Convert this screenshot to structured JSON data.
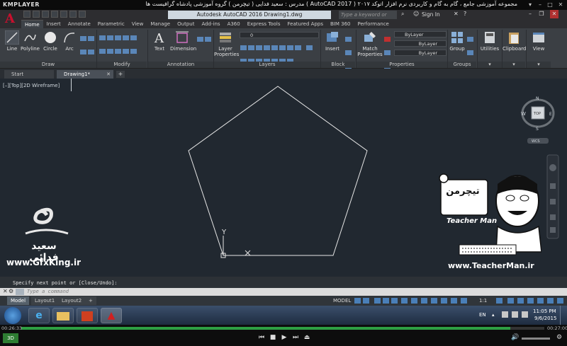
{
  "player": {
    "logo": "KMPLAYER",
    "title": "مجموعه آموزشی جامع ، گام به گام و کاربردی نرم افزار  اتوکد ٢٠١٧ ( AutoCAD  2017 )  مدرس : سعید فدایی ( تیچرمن ) گروه آموزشی پادشاه گرافیست ها",
    "time_elapsed": "00:26:33",
    "time_total": "00:27:00",
    "progress_fraction": 0.935
  },
  "autocad": {
    "app_title": "Autodesk AutoCAD 2016   Drawing1.dwg",
    "search_placeholder": "Type a keyword or phrase",
    "sign_in": "Sign In",
    "tabs": [
      "Home",
      "Insert",
      "Annotate",
      "Parametric",
      "View",
      "Manage",
      "Output",
      "Add-ins",
      "A360",
      "Express Tools",
      "Featured Apps",
      "BIM 360",
      "Performance"
    ],
    "active_tab": "Home",
    "ribbon": {
      "draw": {
        "label": "Draw",
        "buttons": [
          "Line",
          "Polyline",
          "Circle",
          "Arc"
        ]
      },
      "modify": {
        "label": "Modify"
      },
      "annotation": {
        "label": "Annotation",
        "buttons": [
          "Text",
          "Dimension"
        ]
      },
      "layers": {
        "label": "Layers",
        "button": "Layer Properties",
        "layer_value": "0"
      },
      "block": {
        "label": "Block",
        "button": "Insert"
      },
      "properties": {
        "label": "Properties",
        "button": "Match Properties",
        "values": [
          "ByLayer",
          "ByLayer",
          "ByLayer"
        ]
      },
      "groups": {
        "label": "Groups",
        "button": "Group"
      },
      "utilities": {
        "button": "Utilities"
      },
      "clipboard": {
        "button": "Clipboard"
      },
      "view": {
        "button": "View"
      }
    },
    "file_tabs": [
      "Start",
      "Drawing1*"
    ],
    "viewport_label": "[–][Top][2D Wireframe]",
    "viewcube": {
      "top": "TOP",
      "n": "N",
      "s": "S",
      "e": "E",
      "w": "W",
      "wcs": "WCS"
    },
    "ucs": {
      "y": "Y",
      "x": "X"
    },
    "command_history": "Specify next point or [Close/Undo]:",
    "command_placeholder": "Type a command",
    "layout_tabs": [
      "Model",
      "Layout1",
      "Layout2"
    ],
    "status": {
      "model": "MODEL",
      "scale": "1:1"
    }
  },
  "watermarks": {
    "left_name": "سعید فدائی",
    "left_site": "www.GfxKing.ir",
    "right_logo_fa": "تیچرمن",
    "right_logo_en": "Teacher Man",
    "right_site": "www.TeacherMan.ir"
  },
  "taskbar": {
    "lang": "EN",
    "time": "11:05 PM",
    "date": "9/6/2015"
  }
}
